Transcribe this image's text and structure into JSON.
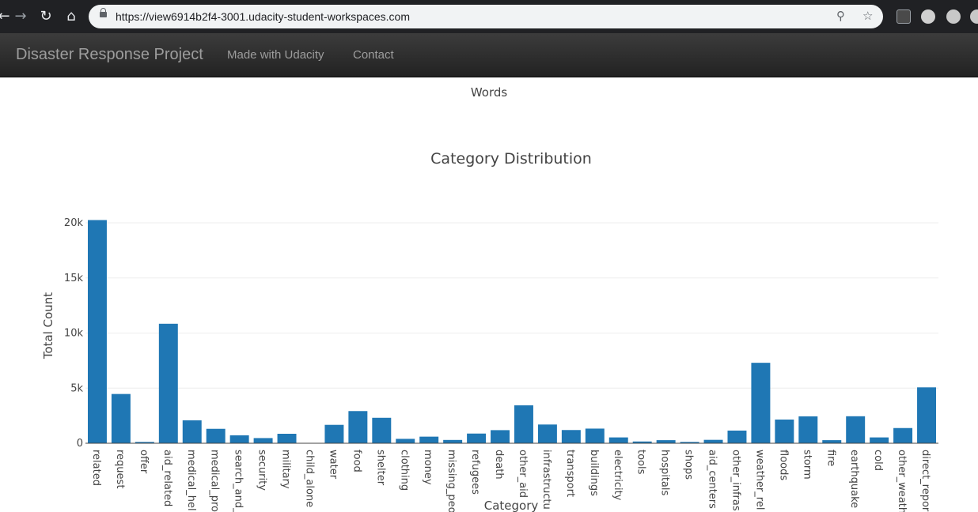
{
  "browser": {
    "url": "https://view6914b2f4-3001.udacity-student-workspaces.com",
    "back_icon": "back-arrow-icon",
    "forward_icon": "forward-arrow-icon",
    "reload_icon": "reload-icon",
    "home_icon": "home-icon"
  },
  "navbar": {
    "brand": "Disaster Response Project",
    "links": [
      "Made with Udacity",
      "Contact"
    ]
  },
  "section_label": "Words",
  "chart_data": {
    "type": "bar",
    "title": "Category Distribution",
    "xlabel": "Category",
    "ylabel": "Total Count",
    "ylim": [
      0,
      20500
    ],
    "yticks": [
      0,
      5000,
      10000,
      15000,
      20000
    ],
    "ytick_labels": [
      "0",
      "5k",
      "10k",
      "15k",
      "20k"
    ],
    "grid": true,
    "bar_color": "#1f77b4",
    "categories": [
      "related",
      "request",
      "offer",
      "aid_related",
      "medical_hel",
      "medical_pro",
      "search_and_",
      "security",
      "military",
      "child_alone",
      "water",
      "food",
      "shelter",
      "clothing",
      "money",
      "missing_peo",
      "refugees",
      "death",
      "other_aid",
      "infrastructu",
      "transport",
      "buildings",
      "electricity",
      "tools",
      "hospitals",
      "shops",
      "aid_centers",
      "other_infras",
      "weather_rel",
      "floods",
      "storm",
      "fire",
      "earthquake",
      "cold",
      "other_weath",
      "direct_repor"
    ],
    "values": [
      20250,
      4470,
      120,
      10840,
      2080,
      1310,
      720,
      470,
      860,
      0,
      1670,
      2920,
      2310,
      400,
      600,
      300,
      880,
      1190,
      3440,
      1700,
      1200,
      1330,
      530,
      160,
      280,
      120,
      310,
      1150,
      7300,
      2150,
      2440,
      280,
      2450,
      530,
      1380,
      5070
    ]
  }
}
